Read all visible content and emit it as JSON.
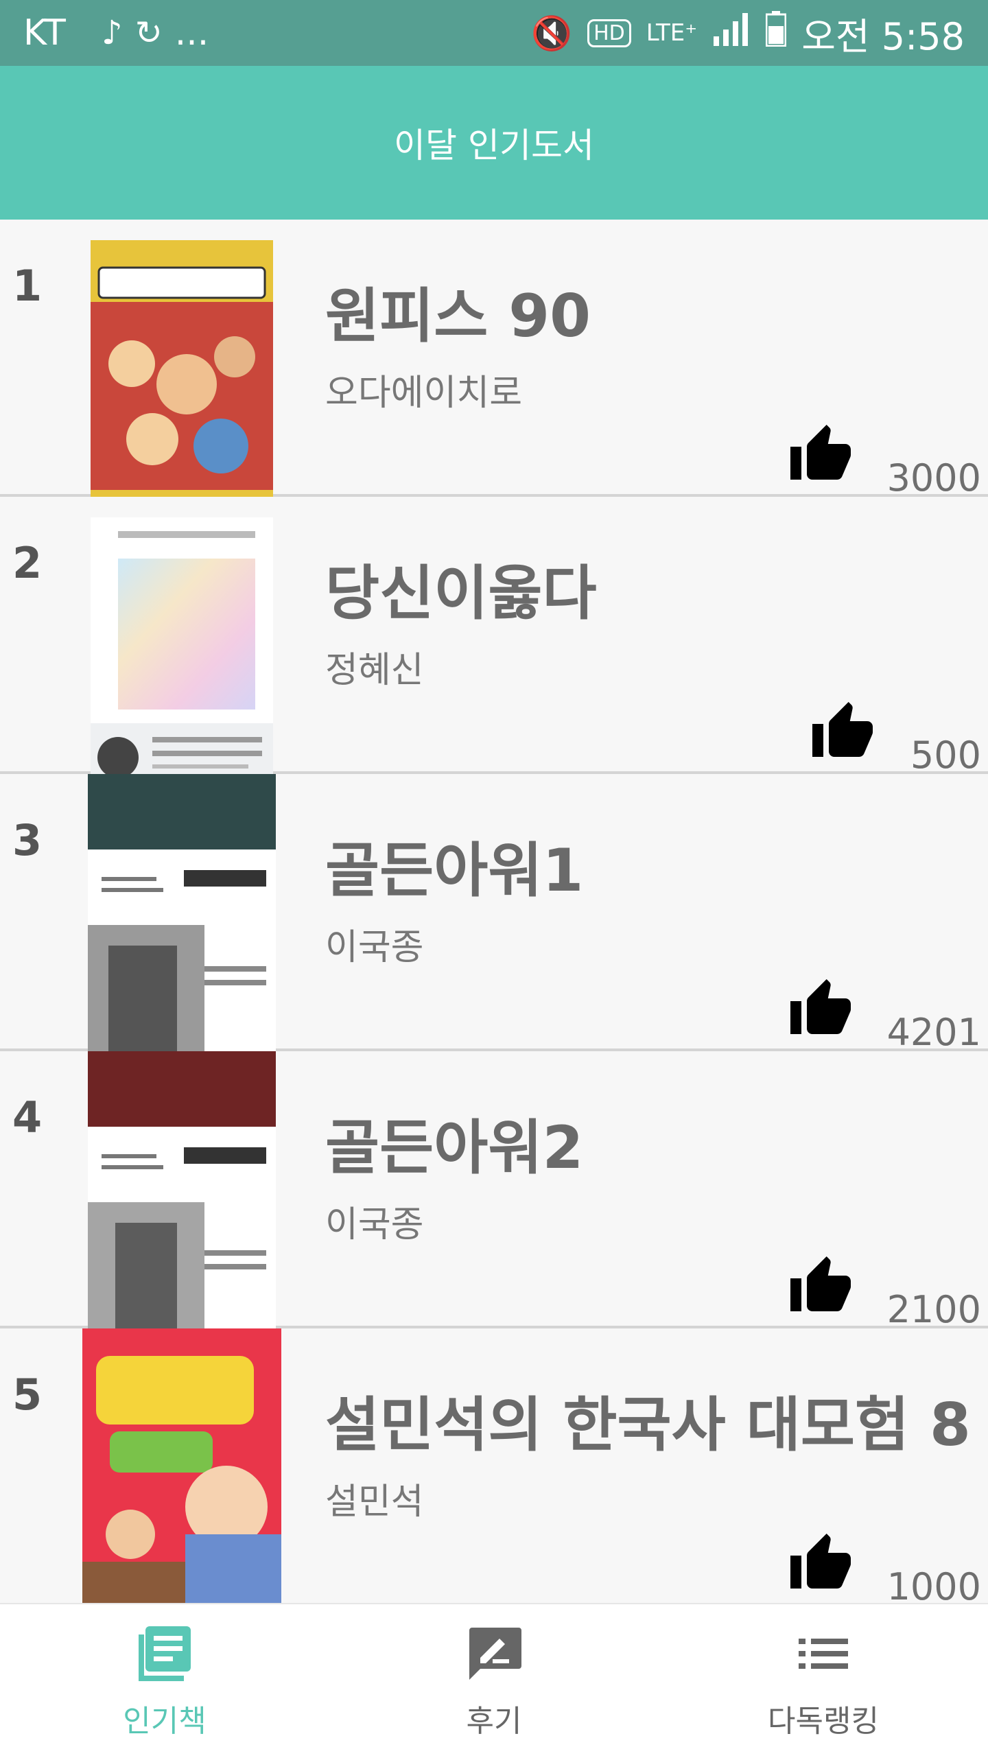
{
  "status_bar": {
    "carrier": "KT",
    "notification_icons": [
      "music-note-icon",
      "sync-icon"
    ],
    "more": "...",
    "right_icons": [
      "mute-icon",
      "hd-icon",
      "lte-icon",
      "signal-icon",
      "battery-icon"
    ],
    "time": "오전 5:58"
  },
  "app_bar": {
    "title": "이달 인기도서"
  },
  "books": [
    {
      "rank": "1",
      "title": "원피스 90",
      "author": "오다에이치로",
      "likes": "3000"
    },
    {
      "rank": "2",
      "title": "당신이옳다",
      "author": "정혜신",
      "likes": "500"
    },
    {
      "rank": "3",
      "title": "골든아워1",
      "author": "이국종",
      "likes": "4201"
    },
    {
      "rank": "4",
      "title": "골든아워2",
      "author": "이국종",
      "likes": "2100"
    },
    {
      "rank": "5",
      "title": "설민석의 한국사 대모험 8",
      "author": "설민석",
      "likes": "1000"
    }
  ],
  "bottom_nav": [
    {
      "label": "인기책",
      "icon": "book-list-icon",
      "active": true
    },
    {
      "label": "후기",
      "icon": "write-review-icon",
      "active": false
    },
    {
      "label": "다독랭킹",
      "icon": "list-icon",
      "active": false
    }
  ],
  "colors": {
    "status_bar": "#569f92",
    "app_bar": "#59c7b5",
    "active_tab": "#59c7b5",
    "inactive_tab": "#666666"
  }
}
